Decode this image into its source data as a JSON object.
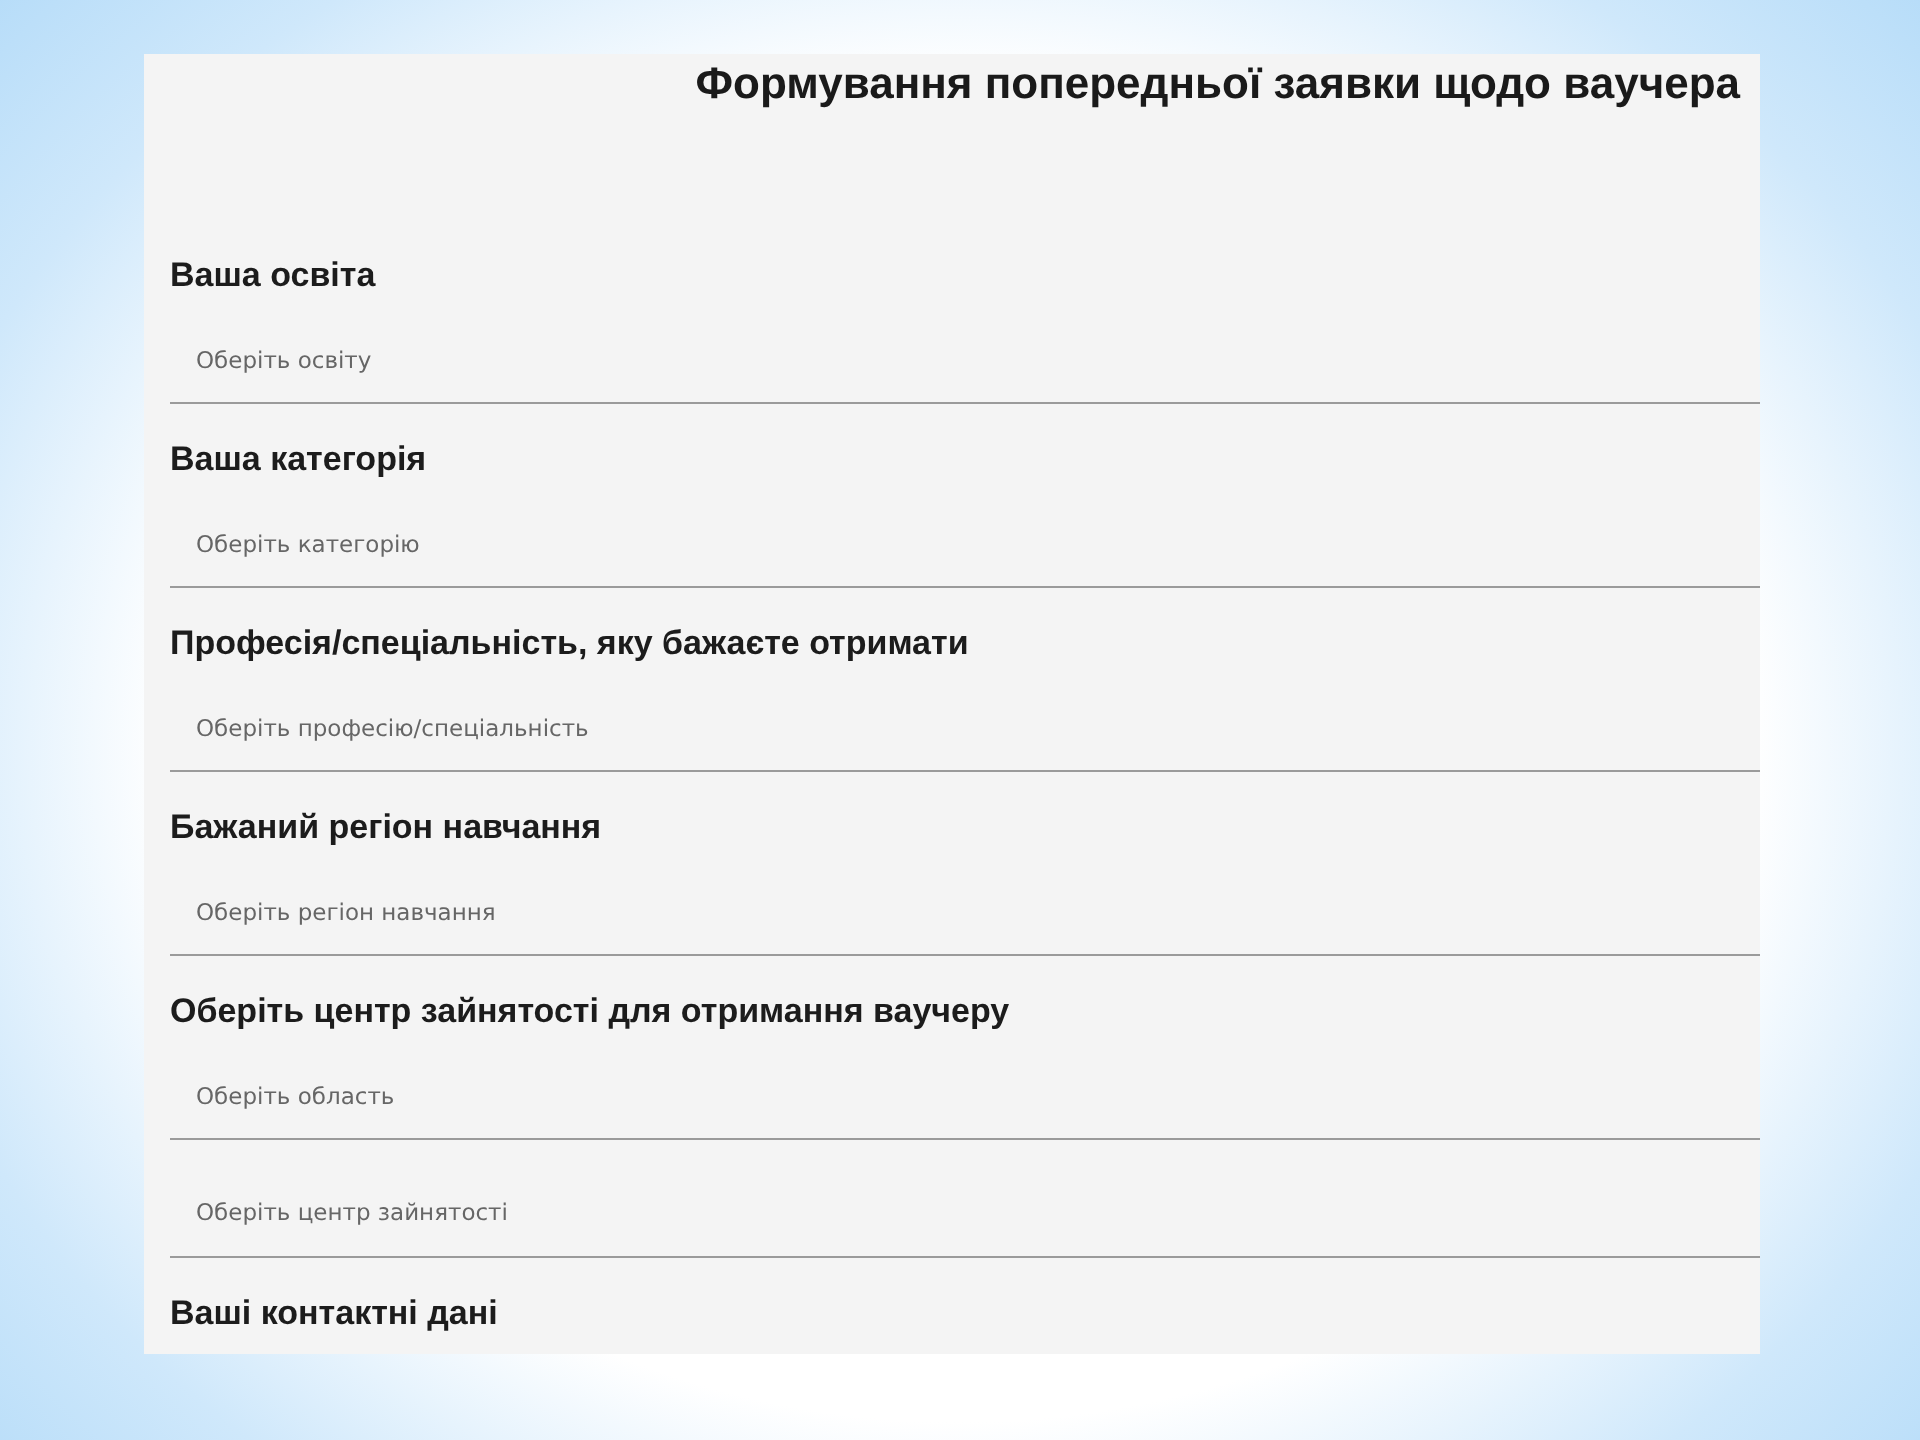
{
  "title": "Формування попередньої заявки щодо ваучера",
  "sections": [
    {
      "label": "Ваша освіта",
      "fields": [
        {
          "placeholder": "Оберіть освіту"
        }
      ]
    },
    {
      "label": "Ваша категорія",
      "fields": [
        {
          "placeholder": "Оберіть категорію"
        }
      ]
    },
    {
      "label": "Професія/спеціальність, яку бажаєте отримати",
      "fields": [
        {
          "placeholder": "Оберіть професію/спеціальність"
        }
      ]
    },
    {
      "label": "Бажаний регіон навчання",
      "fields": [
        {
          "placeholder": "Оберіть регіон навчання"
        }
      ]
    },
    {
      "label": "Оберіть центр зайнятості для отримання ваучеру",
      "fields": [
        {
          "placeholder": "Оберіть область"
        },
        {
          "placeholder": "Оберіть центр зайнятості"
        }
      ]
    },
    {
      "label": "Ваші контактні дані"
    }
  ]
}
